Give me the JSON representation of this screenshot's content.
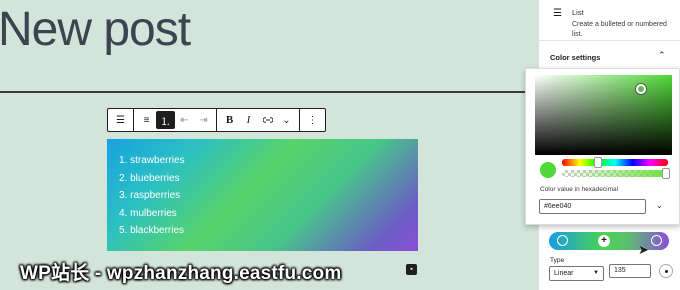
{
  "post": {
    "title": "New post"
  },
  "toolbar": {
    "groups": [
      {
        "buttons": [
          {
            "icon": "list-indent-icon",
            "glyph": "☰"
          }
        ]
      },
      {
        "buttons": [
          {
            "icon": "bullet-list-icon",
            "glyph": "⁝☰"
          },
          {
            "icon": "numbered-list-icon",
            "glyph": "⒈",
            "active": true
          },
          {
            "icon": "outdent-icon",
            "glyph": "⇤"
          },
          {
            "icon": "indent-icon",
            "glyph": "⇥"
          }
        ]
      },
      {
        "buttons": [
          {
            "icon": "bold-icon",
            "label": "B"
          },
          {
            "icon": "italic-icon",
            "label": "I"
          },
          {
            "icon": "link-icon",
            "glyph": "⊂⊃"
          },
          {
            "icon": "chevron-down-icon",
            "glyph": "⌄"
          }
        ]
      },
      {
        "buttons": [
          {
            "icon": "more-options-icon",
            "glyph": "⋮"
          }
        ]
      }
    ]
  },
  "list_block": {
    "items": [
      "1. strawberries",
      "2. blueberries",
      "3. raspberries",
      "4. mulberries",
      "5. blackberries"
    ],
    "gradient_colors": [
      "#17a2e0",
      "#56d36a",
      "#8a4fd8"
    ]
  },
  "watermark": {
    "text": "WP站长 - wpzhanzhang.eastfu.com"
  },
  "sidebar": {
    "block_card": {
      "title": "List",
      "description": "Create a bulleted or numbered list."
    },
    "color_settings": {
      "label": "Color settings"
    },
    "picker": {
      "hex_label": "Color value in hexadecimal",
      "hex_value": "#6ee040",
      "swatch_color": "#4ed83a"
    },
    "gradient": {
      "type_label": "Type",
      "type_value": "Linear",
      "angle_value": "135",
      "add_stop": "+",
      "stop_colors": [
        "#1a9ce2",
        "#49d352",
        "#8a4fd8"
      ]
    }
  }
}
